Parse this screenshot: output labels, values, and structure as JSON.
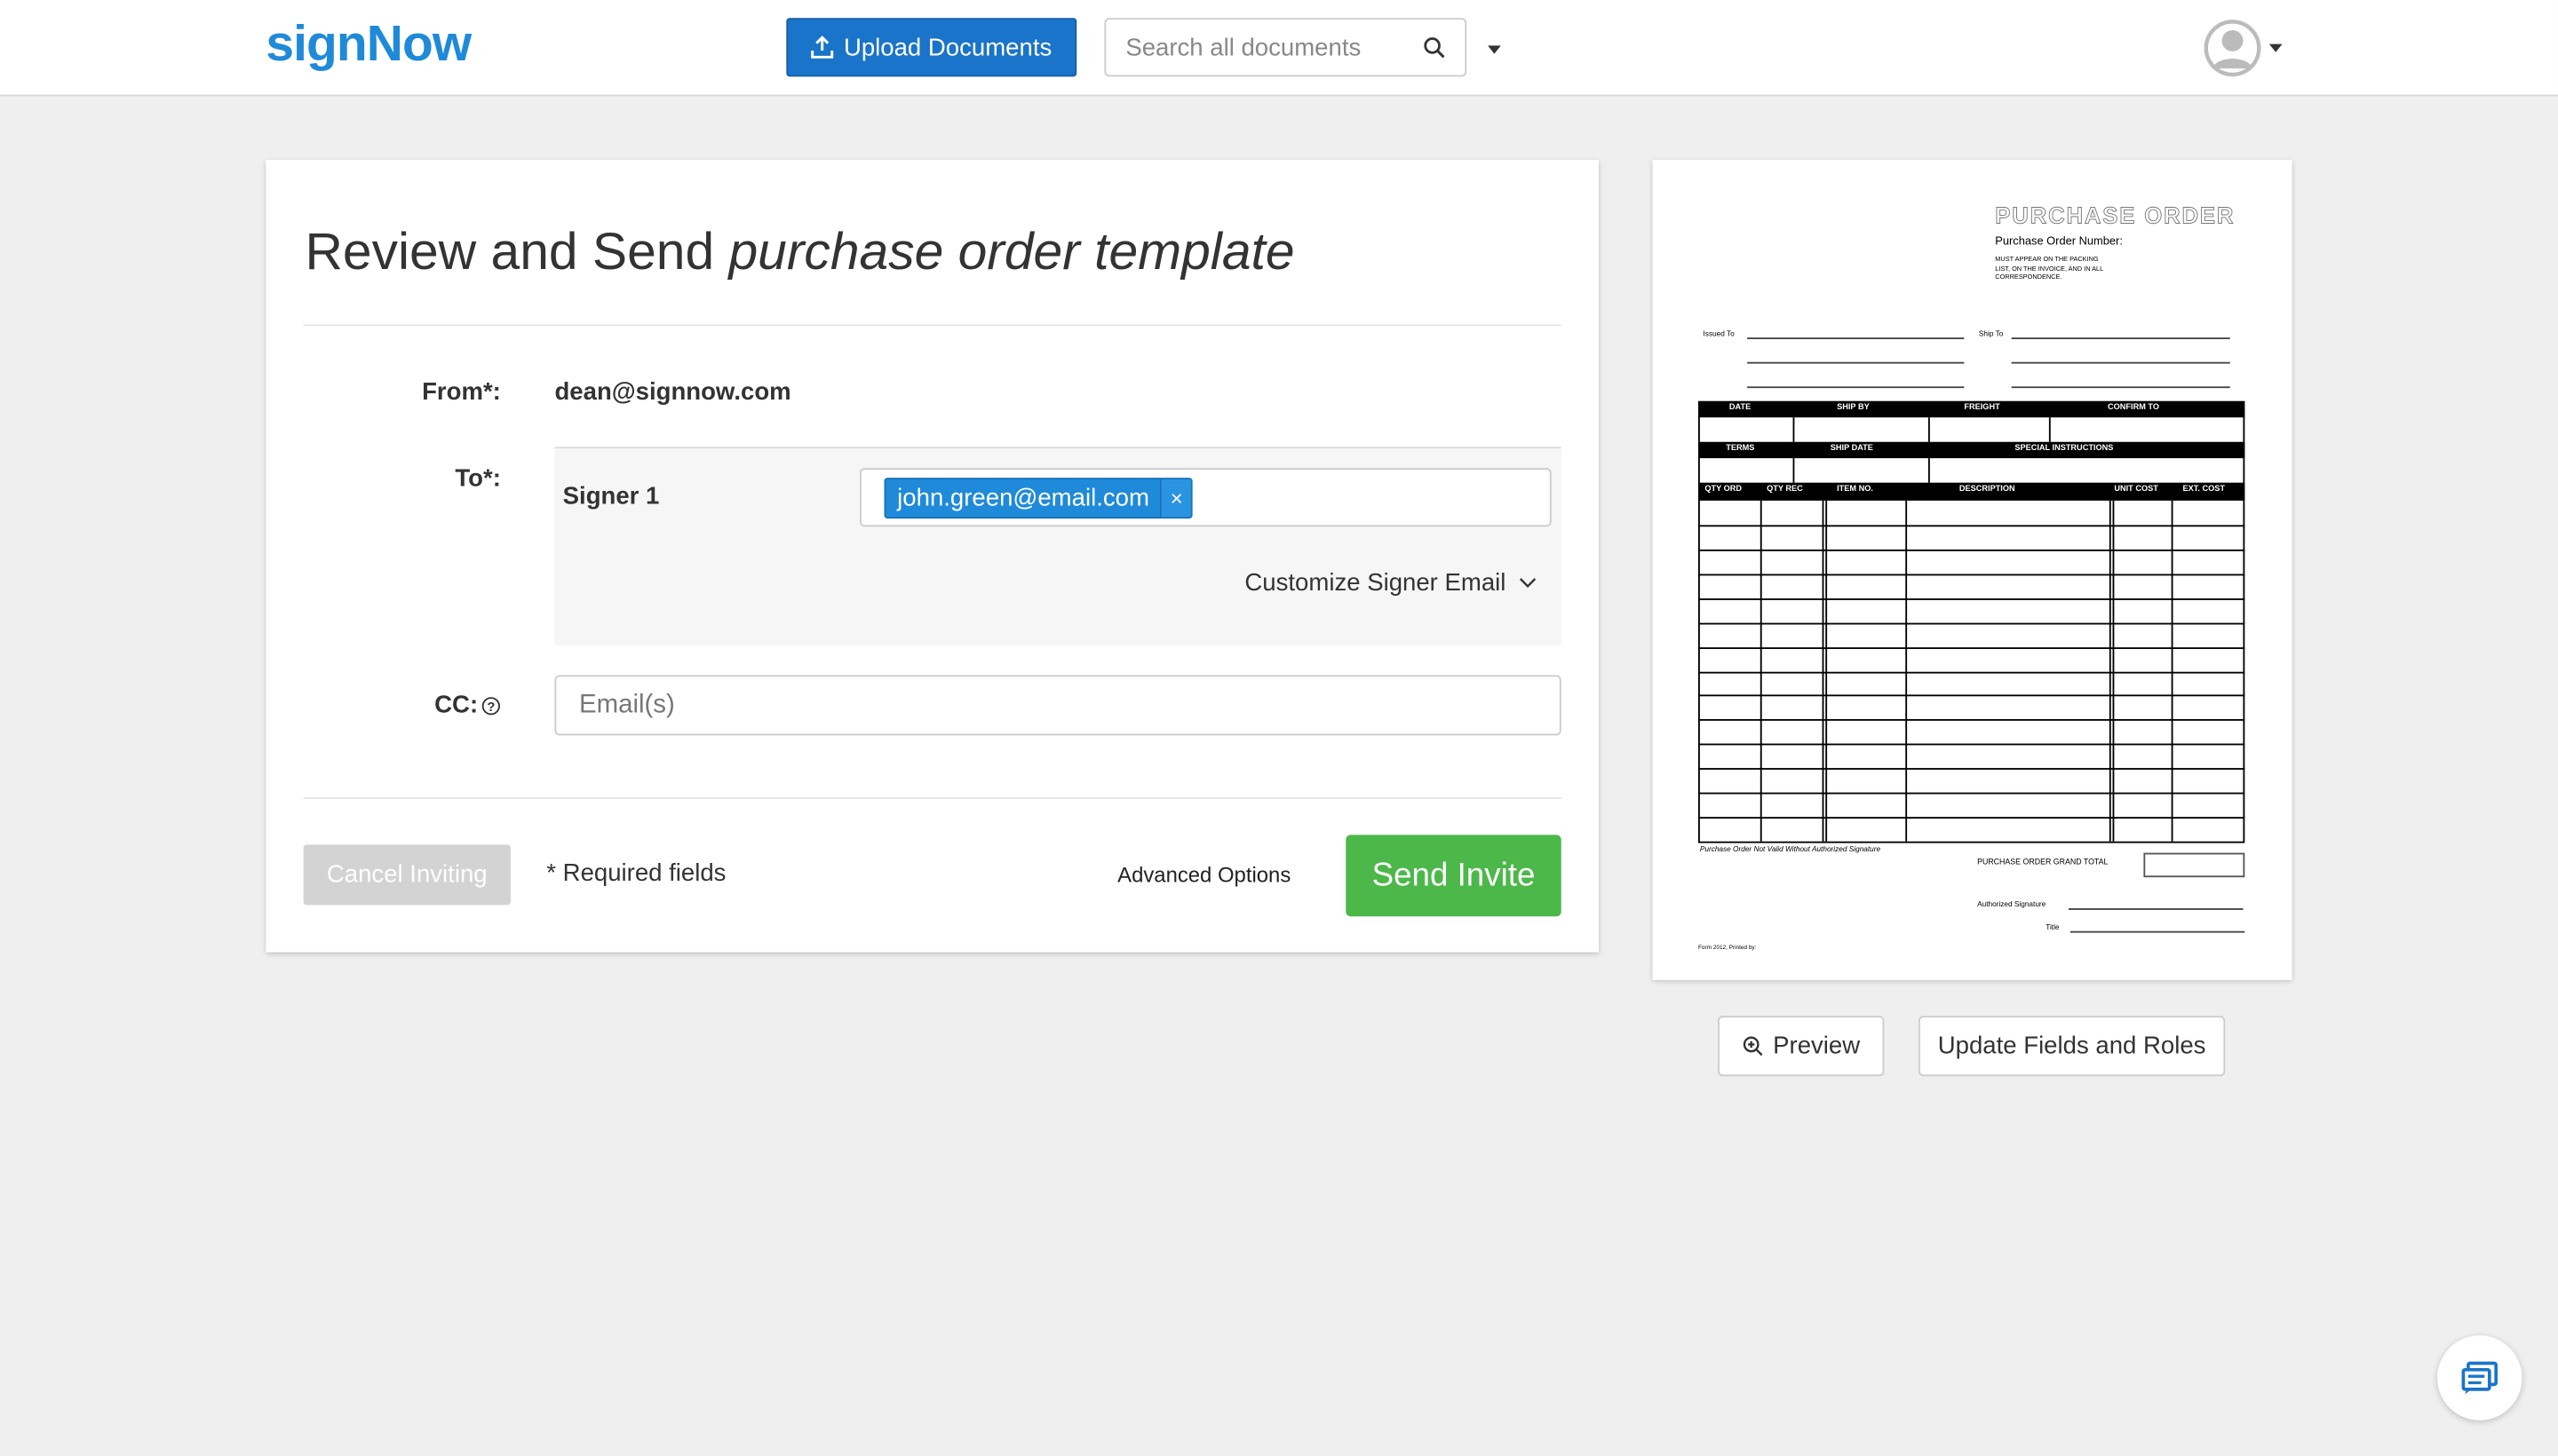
{
  "header": {
    "logo": "signNow",
    "upload_label": "Upload Documents",
    "search_placeholder": "Search all documents"
  },
  "form": {
    "title_prefix": "Review and Send ",
    "title_doc": "purchase order template",
    "from_label": "From*:",
    "from_value": "dean@signnow.com",
    "to_label": "To*:",
    "signer_label": "Signer 1",
    "signer_email": "john.green@email.com",
    "remove_token": "×",
    "customize_label": "Customize Signer Email",
    "cc_label": "CC:",
    "cc_placeholder": "Email(s)",
    "cancel_label": "Cancel Inviting",
    "required_note": "* Required fields",
    "advanced_label": "Advanced Options",
    "send_label": "Send Invite"
  },
  "preview": {
    "doc": {
      "title": "PURCHASE ORDER",
      "po_number": "Purchase Order Number:",
      "note": [
        "MUST APPEAR ON THE PACKING",
        "LIST, ON THE  INVOICE, AND IN ALL",
        "CORRESPONDENCE."
      ],
      "issued_to": "Issued To",
      "ship_to": "Ship To",
      "row1": [
        "DATE",
        "SHIP BY",
        "FREIGHT",
        "CONFIRM TO"
      ],
      "row2": [
        "TERMS",
        "SHIP DATE",
        "SPECIAL INSTRUCTIONS"
      ],
      "items": [
        "QTY ORD",
        "QTY REC",
        "ITEM NO.",
        "DESCRIPTION",
        "UNIT COST",
        "EXT. COST"
      ],
      "not_valid": "Purchase Order Not Valid Without Authorized Signature",
      "grand_total": "PURCHASE ORDER GRAND TOTAL",
      "auth_sig": "Authorized Signature",
      "sig_title": "Title",
      "form_no": "Form 2012, Printed by:"
    },
    "preview_label": "Preview",
    "update_label": "Update Fields and Roles"
  },
  "colors": {
    "brand": "#1f8ad9",
    "upload": "#1a74c9",
    "send": "#4cb849"
  }
}
